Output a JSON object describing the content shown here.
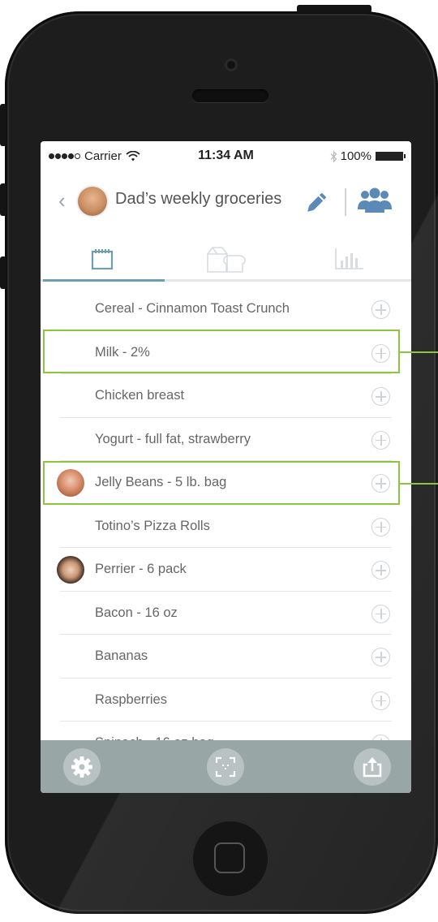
{
  "status_bar": {
    "carrier": "Carrier",
    "time": "11:34 AM",
    "battery": "100%"
  },
  "nav": {
    "title": "Dad’s weekly groceries",
    "icons": [
      "back-chevron-icon",
      "pencil-icon",
      "people-icon"
    ]
  },
  "tabs": [
    {
      "icon": "notepad-icon",
      "active": true
    },
    {
      "icon": "carton-bread-icon",
      "active": false
    },
    {
      "icon": "bar-chart-icon",
      "active": false
    }
  ],
  "items": [
    {
      "label": "Cereal - Cinnamon Toast Crunch",
      "avatar": false,
      "highlighted": false
    },
    {
      "label": "Milk - 2%",
      "avatar": false,
      "highlighted": true
    },
    {
      "label": "Chicken breast",
      "avatar": false,
      "highlighted": false
    },
    {
      "label": "Yogurt - full fat, strawberry",
      "avatar": false,
      "highlighted": false
    },
    {
      "label": "Jelly Beans - 5 lb. bag",
      "avatar": true,
      "highlighted": true
    },
    {
      "label": "Totino’s Pizza Rolls",
      "avatar": false,
      "highlighted": false
    },
    {
      "label": "Perrier - 6 pack",
      "avatar": true,
      "highlighted": false
    },
    {
      "label": "Bacon - 16 oz",
      "avatar": false,
      "highlighted": false
    },
    {
      "label": "Bananas",
      "avatar": false,
      "highlighted": false
    },
    {
      "label": "Raspberries",
      "avatar": false,
      "highlighted": false
    },
    {
      "label": "Spinach - 16 oz bag",
      "avatar": false,
      "highlighted": false
    }
  ],
  "toolbar": {
    "icons": [
      "gear-icon",
      "scan-icon",
      "share-icon"
    ]
  },
  "colors": {
    "accent": "#6f9eae",
    "highlight": "#8cc63f",
    "toolbar": "#99a6a6",
    "icon_blue": "#5b8ab7"
  }
}
